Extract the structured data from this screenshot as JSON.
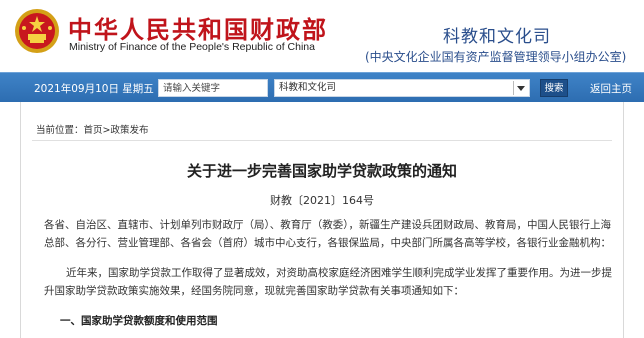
{
  "header": {
    "ministry_cn": "中华人民共和国财政部",
    "ministry_en": "Ministry of Finance of the People's Republic of China",
    "dept_title": "科教和文化司",
    "dept_subtitle": "(中央文化企业国有资产监督管理领导小组办公室)",
    "emblem_icon": "national-emblem-icon"
  },
  "toolbar": {
    "date": "2021年09月10日  星期五",
    "search_placeholder": "请输入关键字",
    "category_selected": "科教和文化司",
    "search_button": "搜索",
    "home_link": "返回主页"
  },
  "breadcrumb": {
    "prefix": "当前位置：",
    "items": [
      "首页",
      "政策发布"
    ]
  },
  "document": {
    "title": "关于进一步完善国家助学贷款政策的通知",
    "number": "财教〔2021〕164号",
    "paragraph1": "各省、自治区、直辖市、计划单列市财政厅（局）、教育厅（教委），新疆生产建设兵团财政局、教育局，中国人民银行上海总部、各分行、营业管理部、各省会（首府）城市中心支行，各银保监局，中央部门所属各高等学校，各银行业金融机构：",
    "paragraph2": "近年来，国家助学贷款工作取得了显著成效，对资助高校家庭经济困难学生顺利完成学业发挥了重要作用。为进一步提升国家助学贷款政策实施效果，经国务院同意，现就完善国家助学贷款有关事项通知如下：",
    "section1": "一、国家助学贷款额度和使用范围"
  },
  "colors": {
    "ministry_red": "#c0141b",
    "dept_blue": "#2a4e8c",
    "toolbar_blue": "#3676bc"
  }
}
